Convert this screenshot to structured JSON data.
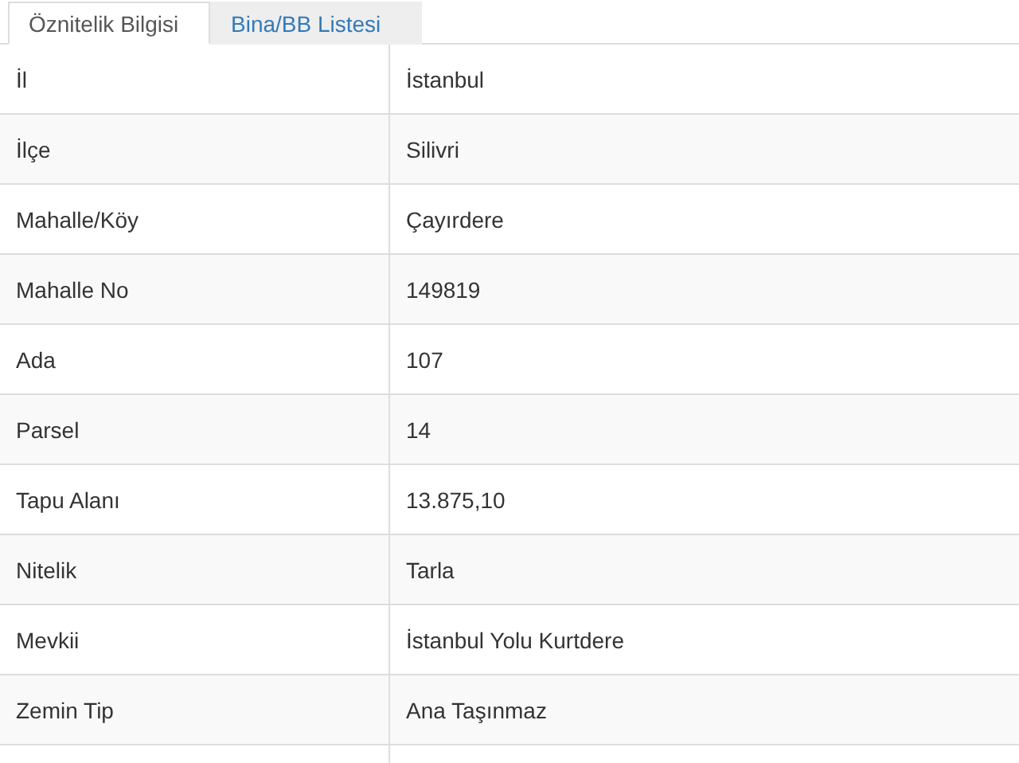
{
  "tabs": [
    {
      "label": "Öznitelik Bilgisi",
      "selected": true
    },
    {
      "label": "Bina/BB Listesi",
      "selected": false
    }
  ],
  "table": {
    "rows": [
      {
        "label": "İl",
        "value": "İstanbul"
      },
      {
        "label": "İlçe",
        "value": "Silivri"
      },
      {
        "label": "Mahalle/Köy",
        "value": "Çayırdere"
      },
      {
        "label": "Mahalle No",
        "value": "149819"
      },
      {
        "label": "Ada",
        "value": "107"
      },
      {
        "label": "Parsel",
        "value": "14"
      },
      {
        "label": "Tapu Alanı",
        "value": "13.875,10"
      },
      {
        "label": "Nitelik",
        "value": "Tarla"
      },
      {
        "label": "Mevkii",
        "value": "İstanbul Yolu Kurtdere"
      },
      {
        "label": "Zemin Tip",
        "value": "Ana Taşınmaz"
      }
    ]
  }
}
